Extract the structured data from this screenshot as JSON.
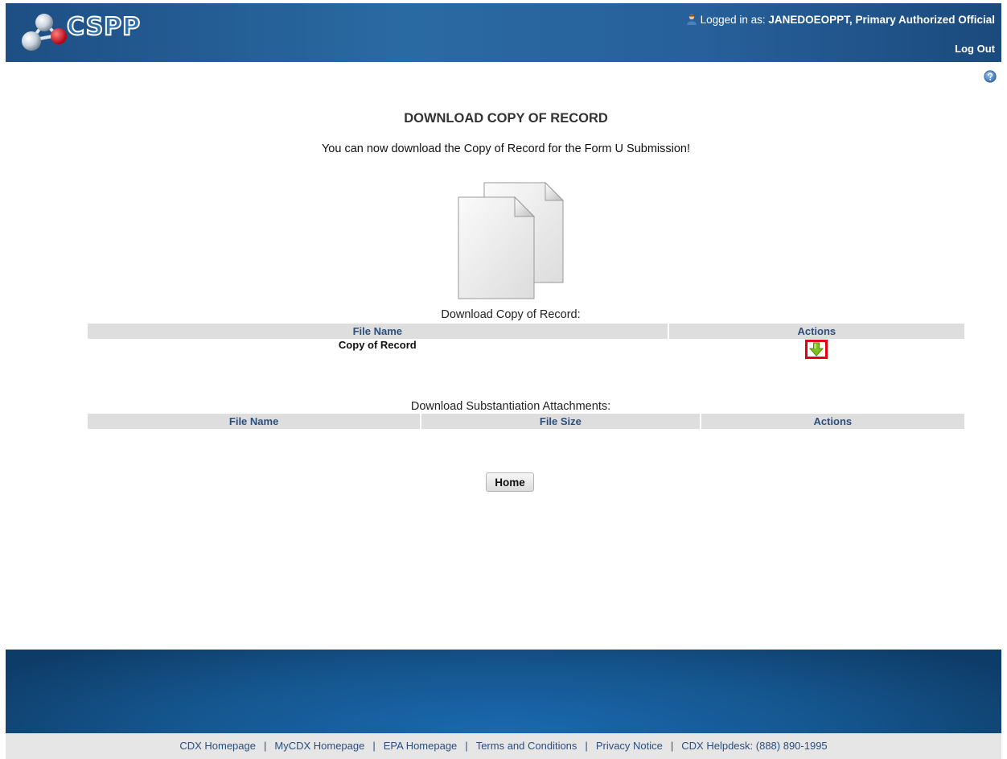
{
  "header": {
    "logo_text": "CSPP",
    "logged_in_prefix": "Logged in as:",
    "username": "JANEDOEOPPT,",
    "role": "Primary Authorized Official",
    "logout_label": "Log Out"
  },
  "main": {
    "title": "DOWNLOAD COPY OF RECORD",
    "intro": "You can now download the Copy of Record for the Form U Submission!",
    "copy_of_record": {
      "caption": "Download Copy of Record:",
      "columns": [
        "File Name",
        "Actions"
      ],
      "rows": [
        {
          "file_name": "Copy of Record",
          "action_icon": "download-arrow-icon"
        }
      ]
    },
    "attachments": {
      "caption": "Download Substantiation Attachments:",
      "columns": [
        "File Name",
        "File Size",
        "Actions"
      ],
      "rows": []
    },
    "home_button": "Home"
  },
  "footer": {
    "links": [
      "CDX Homepage",
      "MyCDX Homepage",
      "EPA Homepage",
      "Terms and Conditions",
      "Privacy Notice"
    ],
    "helpdesk": "CDX Helpdesk: (888) 890-1995",
    "separator": "|"
  },
  "colors": {
    "header_blue": "#2a6aa3",
    "table_header_bg": "#dedede",
    "link_blue": "#2b4f7d",
    "highlight_red": "#e3000f",
    "download_green": "#7cc122"
  }
}
